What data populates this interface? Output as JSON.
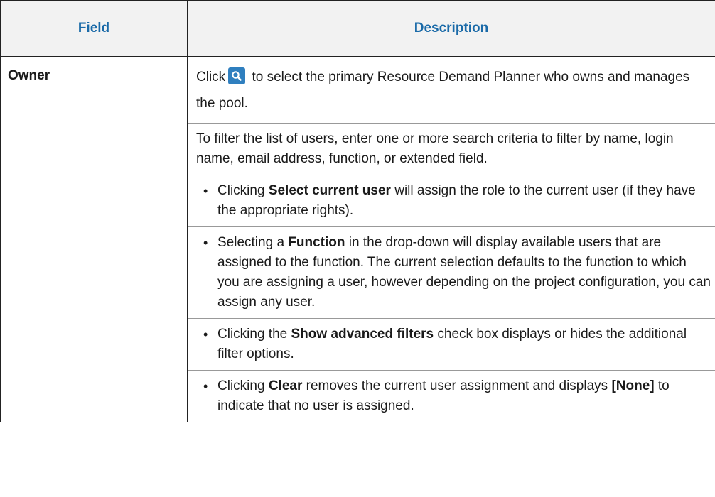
{
  "table": {
    "header_field": "Field",
    "header_description": "Description"
  },
  "row": {
    "field": "Owner",
    "click_prefix": "Click",
    "click_suffix": " to select the primary Resource Demand Planner who owns and manages the pool.",
    "filter_text": "To filter the list of users, enter one or more search criteria to filter by name, login name, email address, function, or extended field.",
    "bullets": [
      {
        "pre": "Clicking ",
        "bold": "Select current user",
        "post": " will assign the role to the current user (if they have the appropriate rights)."
      },
      {
        "pre": "Selecting a ",
        "bold": "Function",
        "post": " in the drop-down will display available users that are assigned to the function. The current selection defaults to the function to which you are assigning a user, however depending on the project configuration, you can assign any user."
      },
      {
        "pre": "Clicking the ",
        "bold": "Show advanced filters",
        "post": " check box displays or hides the additional filter options."
      },
      {
        "pre": "Clicking ",
        "bold": "Clear",
        "post": " removes the current user assignment and displays ",
        "bold2": "[None]",
        "post2": " to indicate that no user is assigned."
      }
    ]
  },
  "colors": {
    "header_text": "#1a6aa8",
    "header_bg": "#f2f2f2",
    "icon_bg": "#2f7fbf"
  },
  "icons": {
    "lookup": "search-icon"
  }
}
